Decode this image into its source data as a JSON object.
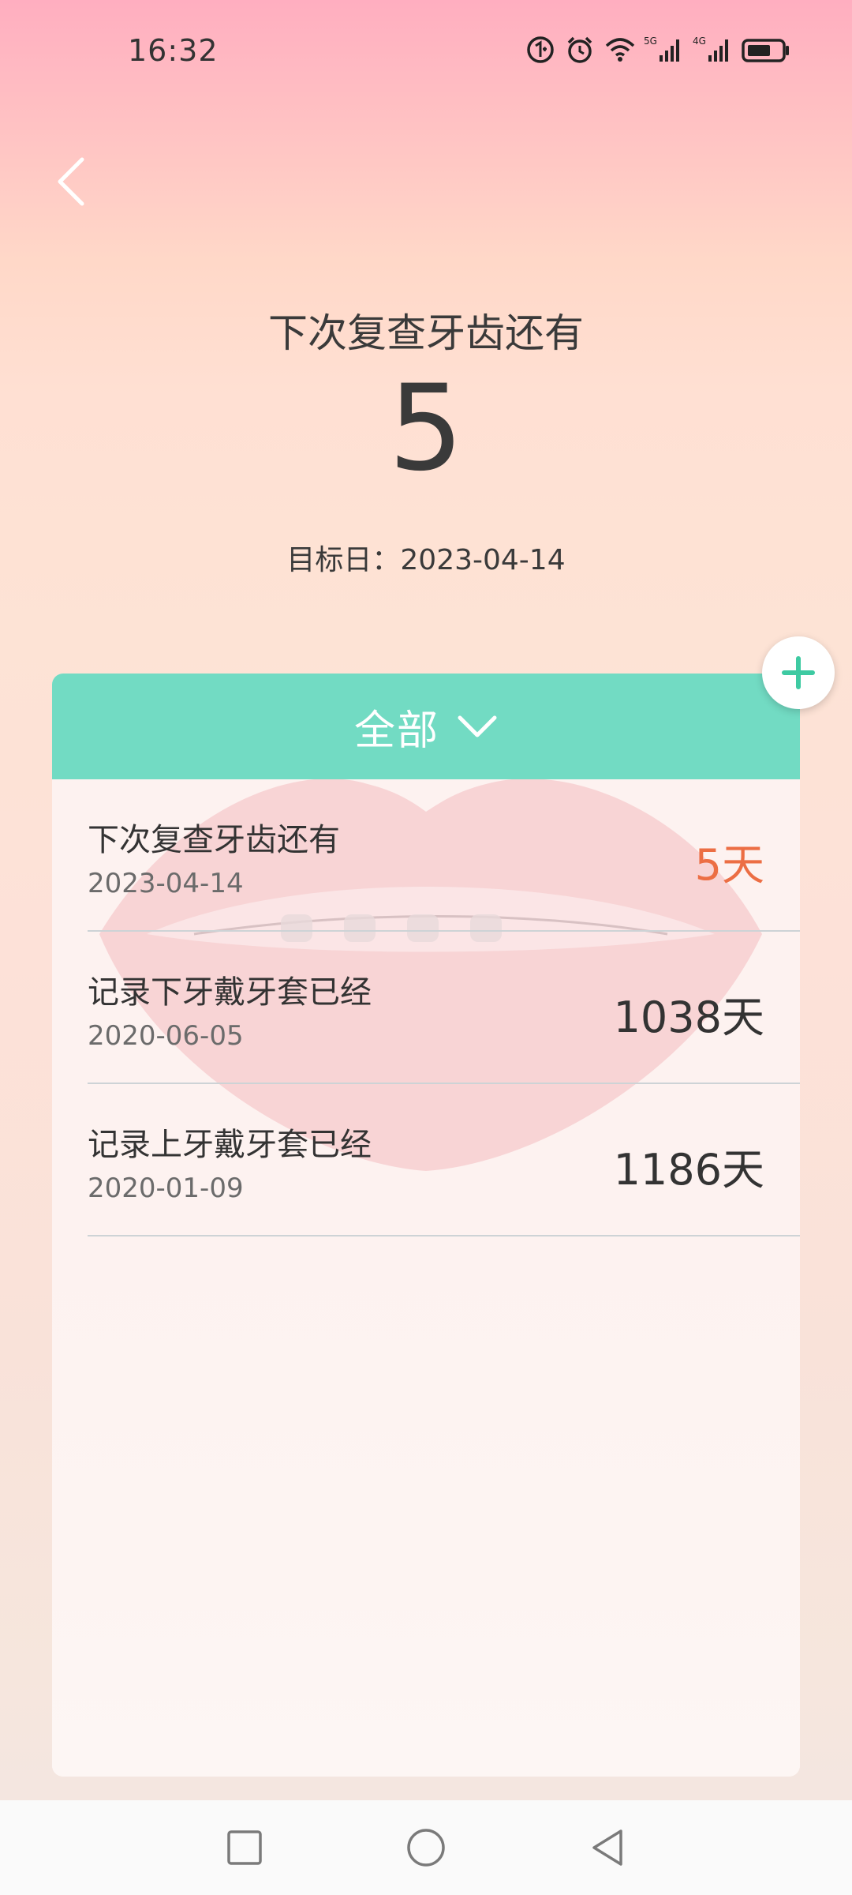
{
  "status_bar": {
    "time": "16:32",
    "icons": [
      "data-saver-icon",
      "alarm-icon",
      "wifi-icon",
      "signal-5g-icon",
      "signal-4g-icon",
      "battery-icon"
    ],
    "network_labels": [
      "5G",
      "4G"
    ]
  },
  "header": {
    "back_icon": "chevron-left-icon"
  },
  "hero": {
    "title": "下次复查牙齿还有",
    "count": "5",
    "target_label": "目标日：",
    "target_date": "2023-04-14"
  },
  "add_button": {
    "icon": "plus-icon",
    "color": "#3ecaa2"
  },
  "filter": {
    "label": "全部",
    "icon": "chevron-down-icon",
    "background": "#72dbc3"
  },
  "events": [
    {
      "title": "下次复查牙齿还有",
      "date": "2023-04-14",
      "days": "5天",
      "highlight": true
    },
    {
      "title": "记录下牙戴牙套已经",
      "date": "2020-06-05",
      "days": "1038天",
      "highlight": false
    },
    {
      "title": "记录上牙戴牙套已经",
      "date": "2020-01-09",
      "days": "1186天",
      "highlight": false
    }
  ],
  "colors": {
    "highlight": "#ec6e44",
    "text": "#333333"
  },
  "nav_bar": {
    "icons": [
      "recents-square-icon",
      "home-circle-icon",
      "back-triangle-icon"
    ]
  }
}
